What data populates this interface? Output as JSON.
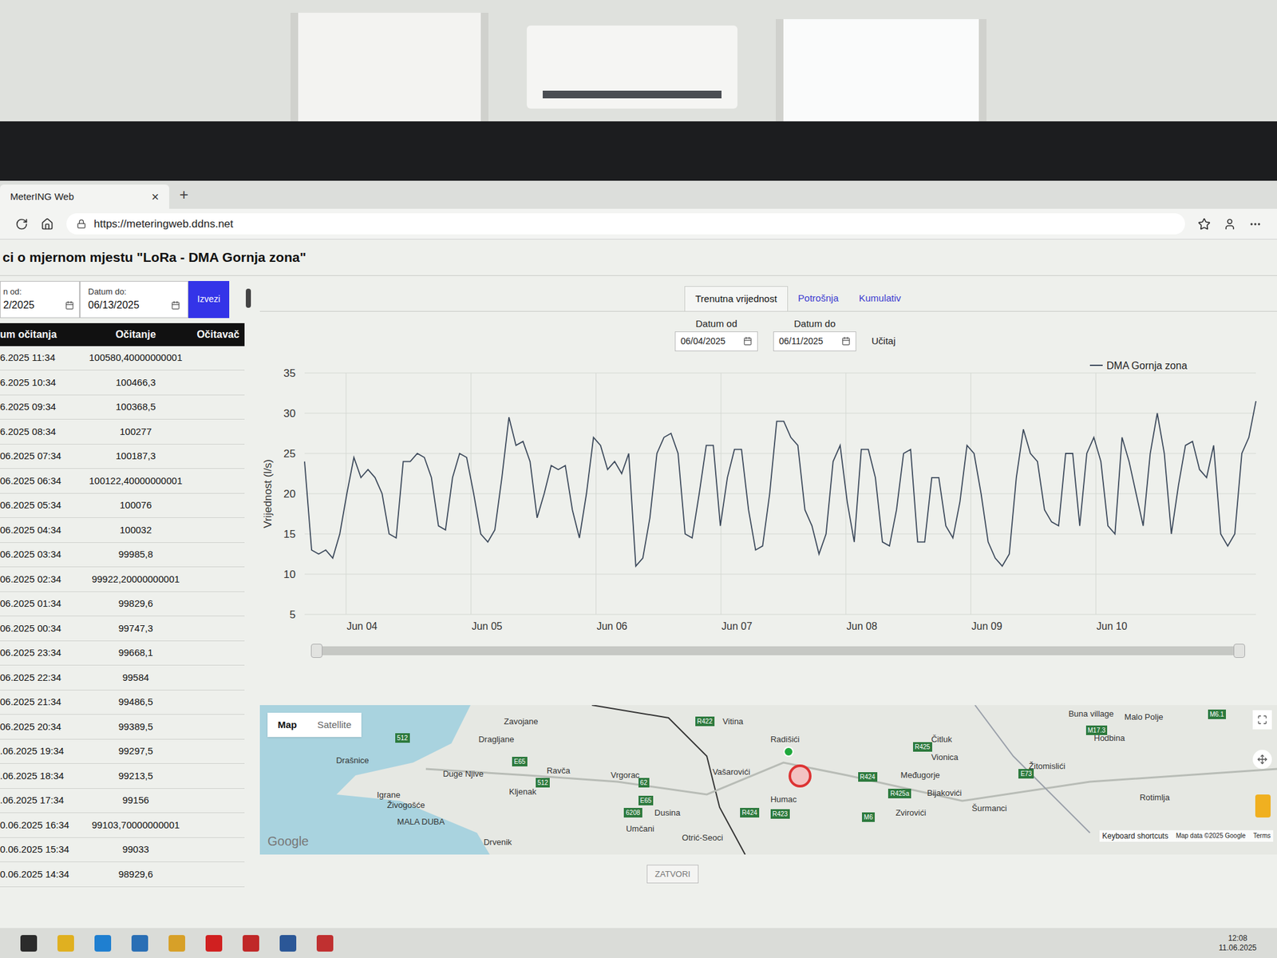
{
  "browser": {
    "tab_title": "MeterING Web",
    "tab_close": "×",
    "new_tab": "+",
    "url": "https://meteringweb.ddns.net"
  },
  "page": {
    "title": "ci o mjernom mjestu \"LoRa - DMA Gornja zona\""
  },
  "filters": {
    "from_label": "n od:",
    "from_value": "2/2025",
    "to_label": "Datum do:",
    "to_value": "06/13/2025",
    "export_button": "Izvezi"
  },
  "table": {
    "columns": [
      "um očitanja",
      "Očitanje",
      "Očitavač"
    ],
    "rows": [
      {
        "date": "6.2025 11:34",
        "reading": "100580,40000000001"
      },
      {
        "date": "6.2025 10:34",
        "reading": "100466,3"
      },
      {
        "date": "6.2025 09:34",
        "reading": "100368,5"
      },
      {
        "date": "6.2025 08:34",
        "reading": "100277"
      },
      {
        "date": "06.2025 07:34",
        "reading": "100187,3"
      },
      {
        "date": "06.2025 06:34",
        "reading": "100122,40000000001"
      },
      {
        "date": "06.2025 05:34",
        "reading": "100076"
      },
      {
        "date": "06.2025 04:34",
        "reading": "100032"
      },
      {
        "date": "06.2025 03:34",
        "reading": "99985,8"
      },
      {
        "date": "06.2025 02:34",
        "reading": "99922,20000000001"
      },
      {
        "date": "06.2025 01:34",
        "reading": "99829,6"
      },
      {
        "date": "06.2025 00:34",
        "reading": "99747,3"
      },
      {
        "date": "06.2025 23:34",
        "reading": "99668,1"
      },
      {
        "date": "06.2025 22:34",
        "reading": "99584"
      },
      {
        "date": "06.2025 21:34",
        "reading": "99486,5"
      },
      {
        "date": "06.2025 20:34",
        "reading": "99389,5"
      },
      {
        "date": ".06.2025 19:34",
        "reading": "99297,5"
      },
      {
        "date": ".06.2025 18:34",
        "reading": "99213,5"
      },
      {
        "date": ".06.2025 17:34",
        "reading": "99156"
      },
      {
        "date": "0.06.2025 16:34",
        "reading": "99103,70000000001"
      },
      {
        "date": "0.06.2025 15:34",
        "reading": "99033"
      },
      {
        "date": "0.06.2025 14:34",
        "reading": "98929,6"
      }
    ]
  },
  "tabs": [
    {
      "label": "Trenutna vrijednost",
      "selected": true
    },
    {
      "label": "Potrošnja",
      "selected": false
    },
    {
      "label": "Kumulativ",
      "selected": false
    }
  ],
  "chart_filters": {
    "from_label": "Datum od",
    "from_value": "06/04/2025",
    "to_label": "Datum do",
    "to_value": "06/11/2025",
    "load_button": "Učitaj"
  },
  "chart": {
    "y_label": "Vrijednost (l/s)",
    "y_ticks": [
      "35",
      "30",
      "25",
      "20",
      "15",
      "10",
      "5"
    ],
    "x_labels": [
      "Jun 04",
      "Jun 05",
      "Jun 06",
      "Jun 07",
      "Jun 08",
      "Jun 09",
      "Jun 10"
    ],
    "series": [
      {
        "name": "DMA Gornja zona",
        "color": "#3d4a5c",
        "values": [
          24,
          13,
          12.5,
          13,
          12,
          15,
          20,
          24.5,
          22,
          23,
          22,
          20,
          15,
          14.5,
          24,
          24,
          25,
          24.5,
          22,
          16,
          15.5,
          22,
          25,
          24.5,
          20,
          15,
          14,
          15.5,
          22,
          29.5,
          26,
          26.5,
          24,
          17,
          20,
          23.5,
          23,
          23.5,
          18,
          14.5,
          20,
          27,
          26,
          23,
          24,
          22.5,
          25,
          11,
          12,
          17,
          25,
          27,
          27.5,
          25,
          15,
          14.5,
          20,
          26,
          26,
          16,
          22,
          25.5,
          25.5,
          18,
          13,
          13.5,
          20,
          29,
          29,
          27,
          26,
          18,
          16,
          12.5,
          15,
          24,
          26,
          19,
          14,
          25.5,
          25.5,
          22,
          14,
          13.5,
          18,
          25,
          25.5,
          14,
          14,
          22,
          22,
          16,
          14.5,
          19,
          26,
          25,
          20,
          14,
          12,
          11,
          12.5,
          22,
          28,
          25,
          24,
          18,
          16.5,
          16,
          25,
          25,
          16,
          25,
          27,
          24,
          16,
          15,
          27,
          24,
          20,
          16,
          25,
          30,
          25,
          15,
          21,
          26,
          26.5,
          23,
          22,
          26,
          15,
          13.5,
          15,
          25,
          27,
          31.5
        ]
      }
    ]
  },
  "map": {
    "types": [
      {
        "label": "Map",
        "selected": true
      },
      {
        "label": "Satellite",
        "selected": false
      }
    ],
    "places": [
      "Zavojane",
      "Dragljane",
      "Drašnice",
      "Duge Njive",
      "Ravča",
      "Vrgorac",
      "Kljenak",
      "Igrane",
      "Živogošće",
      "MALA DUBA",
      "Drvenik",
      "Dusina",
      "Umčani",
      "Otrić-Seoci",
      "Vitina",
      "Radišići",
      "Vašarovići",
      "Humac",
      "Čitluk",
      "Vionica",
      "Međugorje",
      "Bijakovići",
      "Zvirovići",
      "Šurmanci",
      "Žitomislići",
      "Buna village",
      "Malo Polje",
      "Hodbina",
      "Rotimlja"
    ],
    "roads": [
      "512",
      "E65",
      "512",
      "62",
      "E65",
      "6208",
      "R422",
      "R425",
      "R424",
      "R424",
      "R423",
      "M6",
      "R425a",
      "M17.3",
      "E73",
      "M6.1"
    ],
    "logo": "Google",
    "shortcuts": "Keyboard shortcuts",
    "attribution": "Map data ©2025 Google",
    "terms": "Terms"
  },
  "close_button": "ZATVORI",
  "taskbar": {
    "time": "12:08",
    "date": "11.06.2025"
  }
}
